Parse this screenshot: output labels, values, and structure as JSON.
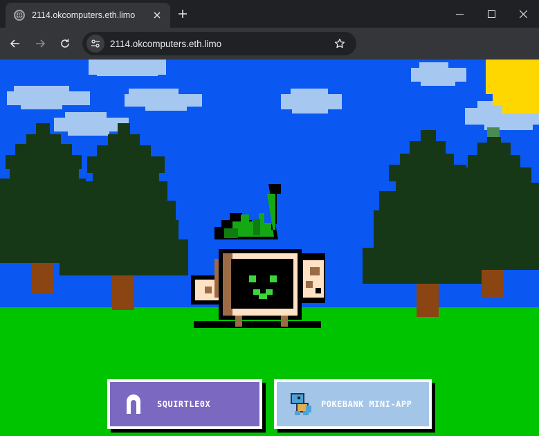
{
  "browser": {
    "tab_title": "2114.okcomputers.eth.limo",
    "url": "2114.okcomputers.eth.limo"
  },
  "page": {
    "buttons": [
      {
        "label": "SQUIRTLE0X",
        "icon": "arch-icon"
      },
      {
        "label": "POKEBANK MINI-APP",
        "icon": "squirtle-icon"
      }
    ]
  },
  "colors": {
    "sky": "#0a57f2",
    "grass": "#00c400",
    "tree": "#173817",
    "trunk": "#8b4513",
    "sun": "#ffd700",
    "cloud": "#a6c8f0",
    "button_purple": "#7b68c0",
    "button_blue": "#a3c5e8"
  }
}
